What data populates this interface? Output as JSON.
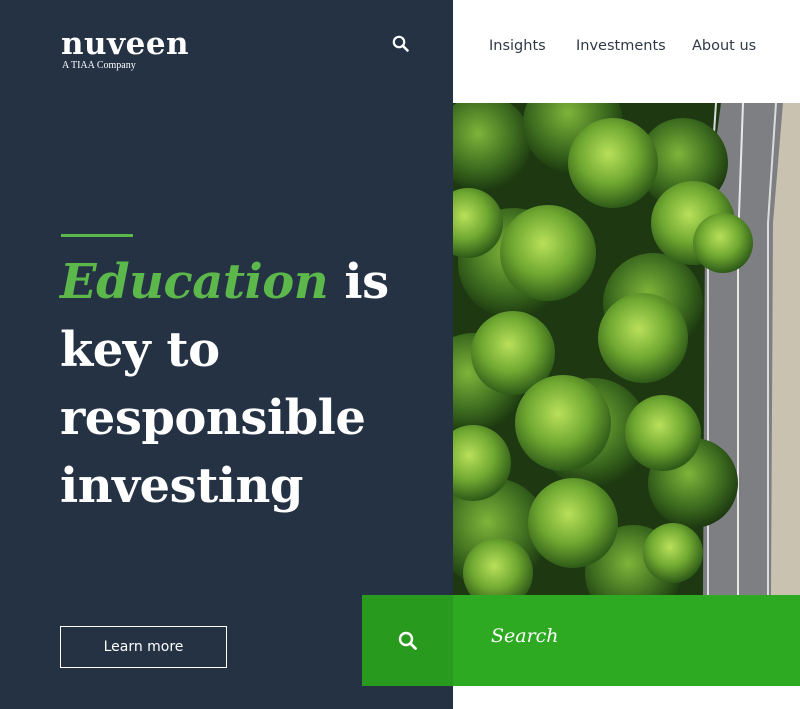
{
  "header": {
    "logo": "nuveen",
    "logo_tagline": "A TIAA Company",
    "search_icon": "search-icon",
    "nav": [
      {
        "label": "Insights"
      },
      {
        "label": "Investments"
      },
      {
        "label": "About us"
      }
    ]
  },
  "hero": {
    "headline_accent": "Education",
    "headline_rest_line1": " is",
    "headline_line2": "key to",
    "headline_line3": "responsible",
    "headline_line4": "investing",
    "cta_label": "Learn more",
    "image_alt_icon": "aerial-forest-road-image"
  },
  "search": {
    "icon": "search-icon",
    "label": "Search"
  },
  "colors": {
    "panel_bg": "#243244",
    "accent_green": "#5cb84a",
    "search_green": "#2eaa22",
    "search_btn_green": "#289a1d",
    "nav_text": "#2f3a46"
  }
}
